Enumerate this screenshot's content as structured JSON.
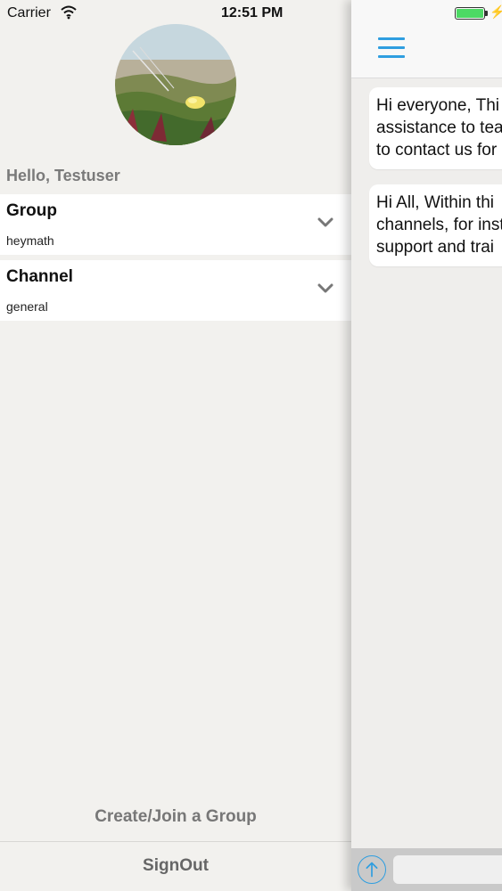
{
  "status_bar": {
    "carrier": "Carrier",
    "time": "12:51 PM",
    "wifi_icon": "wifi-icon",
    "battery_icon": "battery-icon",
    "charging_icon": "bolt-icon"
  },
  "drawer": {
    "greeting": "Hello, Testuser",
    "avatar_icon": "profile-photo",
    "group": {
      "label": "Group",
      "value": "heymath",
      "icon": "chevron-down-icon"
    },
    "channel": {
      "label": "Channel",
      "value": "general",
      "icon": "chevron-down-icon"
    },
    "create_join_label": "Create/Join a Group",
    "signout_label": "SignOut"
  },
  "main": {
    "menu_icon": "hamburger-menu-icon",
    "messages": [
      {
        "lines": [
          "Hi everyone, Thi",
          "assistance to tea",
          "to contact us for"
        ]
      },
      {
        "lines": [
          "Hi All, Within thi",
          "channels, for inst",
          "support and trai"
        ]
      }
    ],
    "composer": {
      "upload_icon": "upload-arrow-icon",
      "input_value": ""
    }
  },
  "colors": {
    "accent": "#2f9ee0",
    "background": "#f2f1ee",
    "battery": "#4cd964"
  }
}
